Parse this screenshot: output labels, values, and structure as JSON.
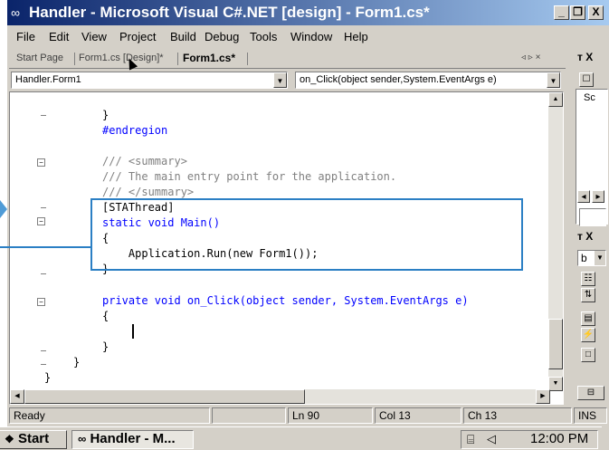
{
  "window": {
    "title": "Handler - Microsoft Visual C#.NET [design] - Form1.cs*",
    "controls": {
      "minimize": "_",
      "restore": "❐",
      "close": "X"
    }
  },
  "menubar": {
    "items": [
      "File",
      "Edit",
      "View",
      "Project",
      "Build",
      "Debug",
      "Tools",
      "Window",
      "Help"
    ]
  },
  "tabs": {
    "start_page": "Start Page",
    "form_design": "Form1.cs [Design]*",
    "form_code": "Form1.cs*",
    "nav_glyphs": "◃ ▹ ×"
  },
  "dropdowns": {
    "class_selector": "Handler.Form1",
    "member_selector": "on_Click(object sender,System.EventArgs e)"
  },
  "code": {
    "lines": [
      "}",
      "#endregion",
      "/// <summary>",
      "/// The main entry point for the application.",
      "/// </summary>",
      "[STAThread]",
      "static void Main()",
      "{",
      "    Application.Run(new Form1());",
      "}",
      "private void on_Click(object sender, System.EventArgs e)",
      "{",
      "}",
      "}",
      "}"
    ]
  },
  "right_panel": {
    "pin_label": "т X",
    "solution_label": "Sc",
    "pin_label_2": "т X",
    "props_dropdown": "b"
  },
  "status": {
    "ready": "Ready",
    "line": "Ln 90",
    "col": "Col 13",
    "ch": "Ch 13",
    "ins": "INS"
  },
  "taskbar": {
    "start": "Start",
    "task_handler": "Handler - M...",
    "clock": "12:00 PM"
  },
  "colors": {
    "title_gradient_start": "#0a246a",
    "highlight": "#2b7fc4",
    "keyword": "#0000ff",
    "comment": "#008000"
  }
}
